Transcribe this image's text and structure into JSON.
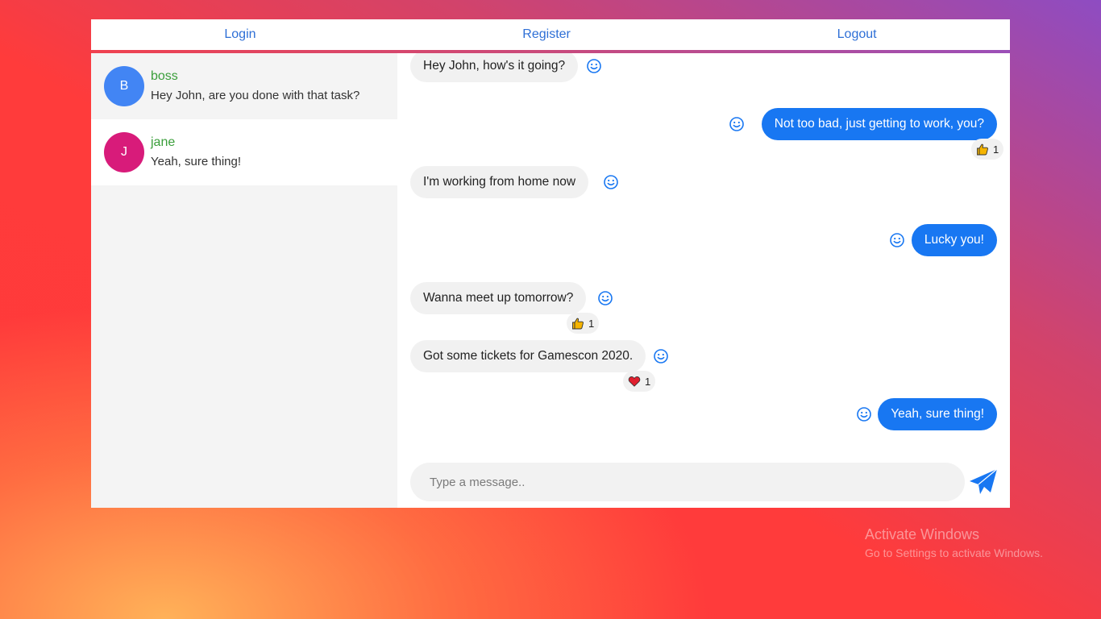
{
  "nav": {
    "login": "Login",
    "register": "Register",
    "logout": "Logout"
  },
  "contacts": [
    {
      "initial": "B",
      "name": "boss",
      "preview": "Hey John, are you done with that task?",
      "avatar_color": "#4285f4"
    },
    {
      "initial": "J",
      "name": "jane",
      "preview": "Yeah, sure thing!",
      "avatar_color": "#d81b7a"
    }
  ],
  "messages": [
    {
      "text": "Hey John, how's it going?",
      "direction": "incoming"
    },
    {
      "text": "Not too bad, just getting to work, you?",
      "direction": "outgoing",
      "reaction": {
        "icon": "thumbs-up",
        "count": "1"
      }
    },
    {
      "text": "I'm working from home now",
      "direction": "incoming"
    },
    {
      "text": "Lucky you!",
      "direction": "outgoing"
    },
    {
      "text": "Wanna meet up tomorrow?",
      "direction": "incoming",
      "reaction": {
        "icon": "thumbs-up",
        "count": "1"
      }
    },
    {
      "text": "Got some tickets for Gamescon 2020.",
      "direction": "incoming",
      "reaction": {
        "icon": "heart",
        "count": "1"
      }
    },
    {
      "text": "Yeah, sure thing!",
      "direction": "outgoing"
    }
  ],
  "composer": {
    "placeholder": "Type a message.."
  },
  "watermark": {
    "line1": "Activate Windows",
    "line2": "Go to Settings to activate Windows."
  },
  "colors": {
    "accent": "#1877f2",
    "link": "#2e6fd6",
    "contact_name": "#3a9e3a"
  }
}
